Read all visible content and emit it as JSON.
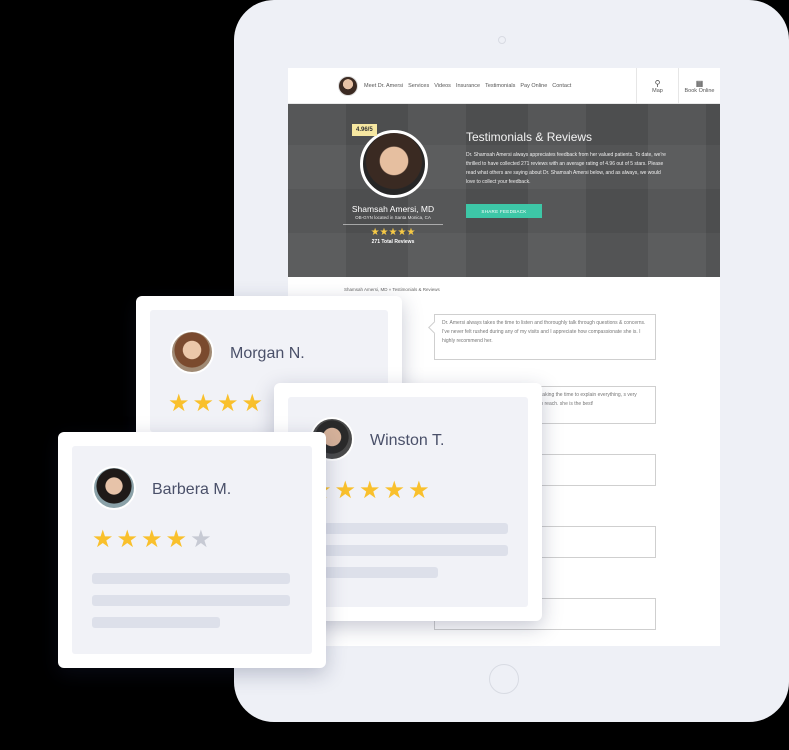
{
  "nav": {
    "links": [
      "Meet Dr. Amersi",
      "Services",
      "Videos",
      "Insurance",
      "Testimonials",
      "Pay Online",
      "Contact"
    ],
    "map_label": "Map",
    "book_label": "Book Online",
    "map_icon": "map-pin-icon",
    "book_icon": "calendar-icon"
  },
  "hero": {
    "rating_badge": "4.96/5",
    "doctor_name": "Shamsah Amersi, MD",
    "doctor_subtitle": "OB-GYN located in Santa Monica, CA",
    "stars": "★★★★★",
    "total_reviews": "271 Total Reviews",
    "title": "Testimonials & Reviews",
    "text": "Dr. Shamsah Amersi always appreciates feedback from her valued patients. To date, we're thrilled to have collected 271 reviews with an average rating of 4.96 out of 5 stars. Please read what others are saying about Dr. Shamsah Amersi below, and as always, we would love to collect your feedback.",
    "share_button": "SHARE FEEDBACK"
  },
  "breadcrumb": "Shamsah Amersi, MD  »  Testimonials & Reviews",
  "reviews": [
    "Dr. Amersi always takes the time to listen and thoroughly talk through questions & concerns. I've never felt rushed during any of my visits and I appreciate how compassionate she is. I highly recommend her.",
    "aring, taking the time to explain everything, s very easy to reach. she is the best!"
  ],
  "cards": {
    "morgan": {
      "name": "Morgan N.",
      "rating": 5
    },
    "winston": {
      "name": "Winston T.",
      "rating": 5
    },
    "barbera": {
      "name": "Barbera M.",
      "rating": 4
    }
  },
  "colors": {
    "star": "#f9c02c",
    "accent_button": "#3dc7a7",
    "rating_badge": "#f6e7a1",
    "name_text": "#4a5069"
  }
}
